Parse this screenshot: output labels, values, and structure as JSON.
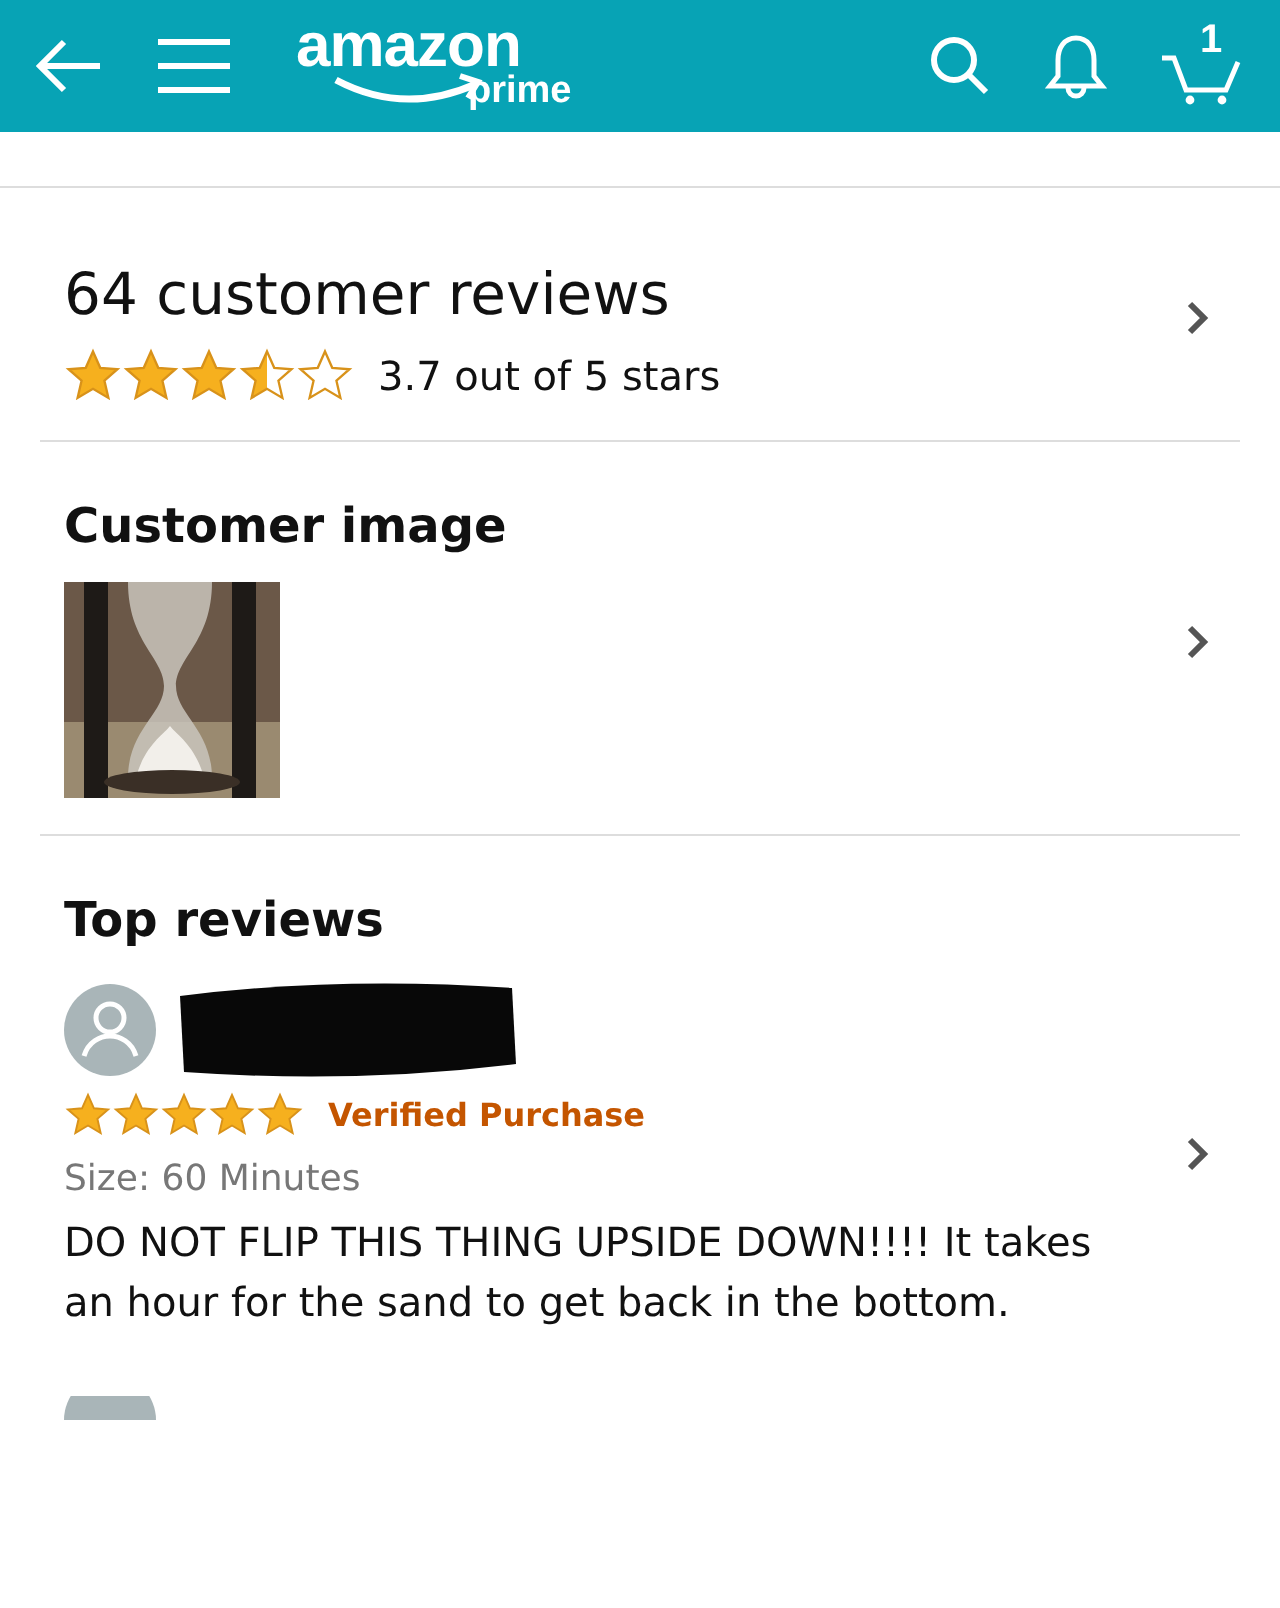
{
  "header": {
    "logo": "amazon",
    "logo_sub": "prime",
    "cart_count": "1"
  },
  "ratings": {
    "title": "64 customer reviews",
    "stars": 3.5,
    "summary": "3.7 out of 5 stars"
  },
  "customer_image": {
    "title": "Customer image"
  },
  "top_reviews": {
    "title": "Top reviews",
    "reviews": [
      {
        "redacted": true,
        "stars": 5,
        "badge": "Verified Purchase",
        "size": "Size: 60 Minutes",
        "text": "DO NOT FLIP THIS THING UPSIDE DOWN!!!! It takes an hour for the sand to get back in the bottom."
      }
    ]
  }
}
